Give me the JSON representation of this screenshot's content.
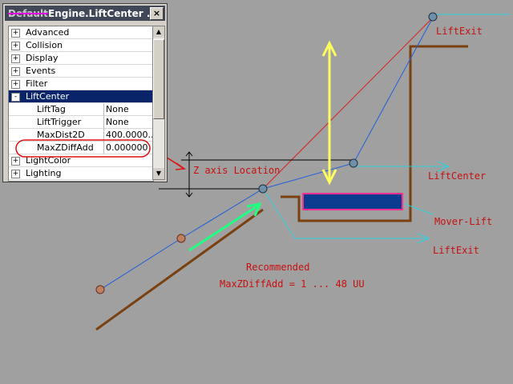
{
  "window": {
    "title_prefix": "Default",
    "title": "Engine.LiftCenter ...",
    "close_icon": "×",
    "categories": [
      {
        "label": "Advanced",
        "expander": "+"
      },
      {
        "label": "Collision",
        "expander": "+"
      },
      {
        "label": "Display",
        "expander": "+"
      },
      {
        "label": "Events",
        "expander": "+"
      },
      {
        "label": "Filter",
        "expander": "+"
      },
      {
        "label": "LiftCenter",
        "expander": "-"
      }
    ],
    "lift_props": [
      {
        "name": "LiftTag",
        "value": "None"
      },
      {
        "name": "LiftTrigger",
        "value": "None"
      },
      {
        "name": "MaxDist2D",
        "value": "400.0000..."
      },
      {
        "name": "MaxZDiffAdd",
        "value": "0.000000"
      }
    ],
    "after_categories": [
      {
        "label": "LightColor",
        "expander": "+"
      },
      {
        "label": "Lighting",
        "expander": "+"
      }
    ]
  },
  "annotations": {
    "z_axis": "Z axis Location",
    "lift_exit_top": "LiftExit",
    "lift_center": "LiftCenter",
    "mover_lift": "Mover-Lift",
    "lift_exit_bottom": "LiftExit",
    "recommended": "Recommended",
    "formula": "MaxZDiffAdd = 1 ... 48 UU"
  },
  "colors": {
    "background": "#a0a0a0",
    "wall": "#7a4010",
    "path_blue": "#1e5fd8",
    "red_line": "#d82020",
    "cyan": "#30d0e0",
    "yellow_arrow": "#ffff60",
    "green_arrow": "#20ff80",
    "mover_fill": "#0a3c90",
    "mover_border": "#ff3090",
    "label_red": "#c81010"
  }
}
